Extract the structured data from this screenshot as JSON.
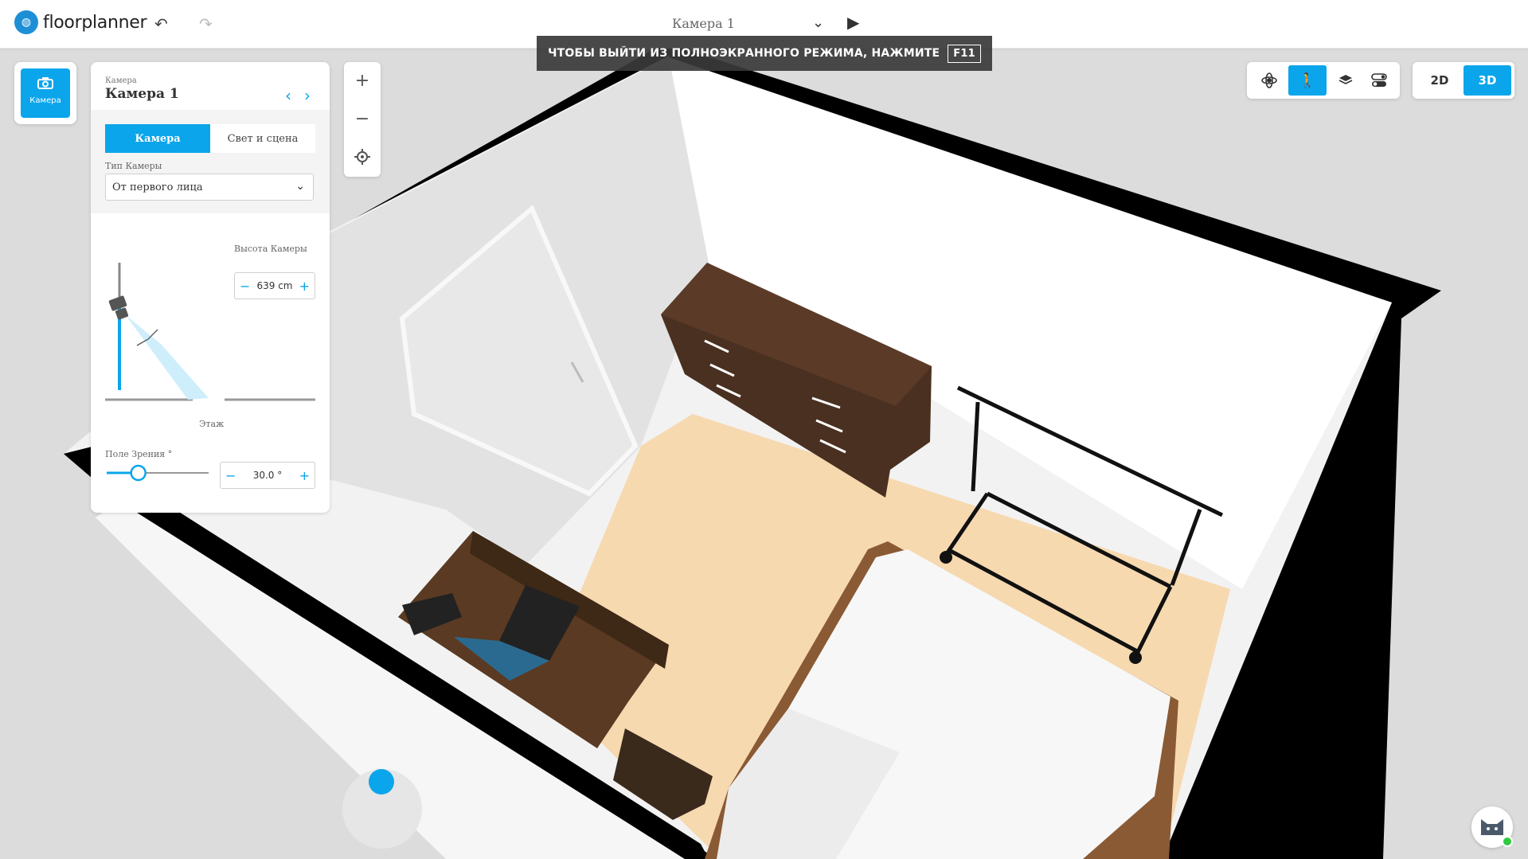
{
  "app": {
    "logo_text": "floorplanner"
  },
  "toolbar": {
    "undo_icon": "↶",
    "redo_icon": "↷",
    "camera_name": "Камера 1",
    "play_icon": "▶"
  },
  "fullscreen_notice": {
    "text": "ЧТОБЫ ВЫЙТИ ИЗ ПОЛНОЭКРАННОГО РЕЖИМА, НАЖМИТЕ",
    "key": "F11"
  },
  "left_tile": {
    "label": "Камера",
    "icon": "camera-icon"
  },
  "panel": {
    "small_label": "Камера",
    "title": "Камера 1",
    "tabs": [
      {
        "label": "Камера",
        "active": true
      },
      {
        "label": "Свет и сцена",
        "active": false
      }
    ],
    "camera_type_label": "Тип Камеры",
    "camera_type_value": "От первого лица",
    "camera_height_label": "Высота Камеры",
    "camera_height_value": "639 cm",
    "floor_label": "Этаж",
    "fov_label": "Поле Зрения °",
    "fov_value": "30.0 °",
    "fov_slider_fraction": 0.31
  },
  "view_tools": [
    {
      "name": "orbit-icon",
      "active": false
    },
    {
      "name": "walk-icon",
      "active": true
    },
    {
      "name": "layers-icon",
      "active": false
    },
    {
      "name": "toggle-icon",
      "active": false
    }
  ],
  "dimension_tools": [
    {
      "label": "2D",
      "active": false
    },
    {
      "label": "3D",
      "active": true
    }
  ],
  "colors": {
    "accent": "#0ba5ec",
    "wall": "#000000",
    "floor": "#f7d9b0",
    "dresser": "#4a3020"
  }
}
